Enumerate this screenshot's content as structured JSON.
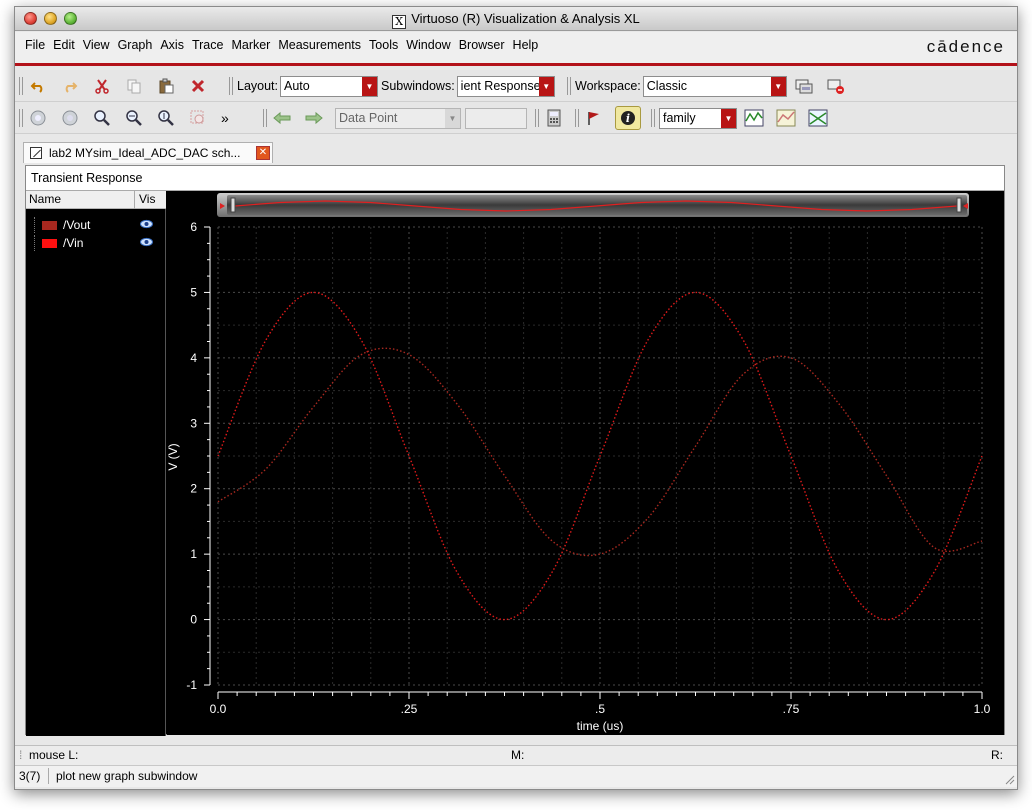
{
  "window": {
    "title": "Virtuoso (R) Visualization & Analysis XL",
    "title_icon_glyph": "X"
  },
  "menu": {
    "items": [
      "File",
      "Edit",
      "View",
      "Graph",
      "Axis",
      "Trace",
      "Marker",
      "Measurements",
      "Tools",
      "Window",
      "Browser",
      "Help"
    ],
    "brand": "cādence",
    "brand_color": "#b3121a"
  },
  "toolbar1": {
    "layout_label": "Layout:",
    "layout_value": "Auto",
    "subwindows_label": "Subwindows:",
    "subwindows_value": "ient Response",
    "workspace_label": "Workspace:",
    "workspace_value": "Classic",
    "icons": [
      "undo-icon",
      "redo-icon",
      "cut-icon",
      "copy-icon",
      "paste-icon",
      "delete-icon",
      "workspace-save-icon",
      "workspace-delete-icon"
    ]
  },
  "toolbar2": {
    "more_glyph": "»",
    "marker_type_value": "Data Point",
    "marker_value_input": "",
    "family_value": "family",
    "icons": [
      "zoom-fit-icon",
      "zoom-out-icon",
      "zoom-in-icon",
      "zoom-x-icon",
      "zoom-y-icon",
      "zoom-box-icon",
      "nav-back-icon",
      "nav-forward-icon",
      "calculator-icon",
      "flag-icon",
      "info-icon",
      "strip-icon",
      "graph-icon",
      "color-icon"
    ]
  },
  "tab": {
    "label": "lab2 MYsim_Ideal_ADC_DAC sch..."
  },
  "panel": {
    "title": "Transient Response",
    "legend_header_name": "Name",
    "legend_header_vis": "Vis",
    "traces": [
      {
        "name": "/Vout",
        "color": "#a8281f"
      },
      {
        "name": "/Vin",
        "color": "#ff1010"
      }
    ]
  },
  "chart_data": {
    "type": "line",
    "title": "",
    "xlabel": "time (us)",
    "ylabel": "V (V)",
    "xlim": [
      0.0,
      1.0
    ],
    "ylim": [
      -1,
      6
    ],
    "xticks": [
      {
        "v": 0.0,
        "label": "0.0"
      },
      {
        "v": 0.25,
        "label": ".25"
      },
      {
        "v": 0.5,
        "label": ".5"
      },
      {
        "v": 0.75,
        "label": ".75"
      },
      {
        "v": 1.0,
        "label": "1.0"
      }
    ],
    "yticks": [
      -1,
      0,
      1,
      2,
      3,
      4,
      5,
      6
    ],
    "grid": true,
    "background": "#000000",
    "series": [
      {
        "name": "/Vin",
        "color": "#e01a1a",
        "x": [
          0.0,
          0.0625,
          0.125,
          0.1875,
          0.25,
          0.3125,
          0.375,
          0.4375,
          0.5,
          0.5625,
          0.625,
          0.6875,
          0.75,
          0.8125,
          0.875,
          0.9375,
          1.0
        ],
        "values": [
          2.5,
          4.27,
          5.0,
          4.27,
          2.5,
          0.73,
          0.0,
          0.73,
          2.5,
          4.27,
          5.0,
          4.27,
          2.5,
          0.73,
          0.0,
          0.73,
          2.5
        ]
      },
      {
        "name": "/Vout",
        "color": "#a8281f",
        "x": [
          0.0,
          0.0625,
          0.125,
          0.1875,
          0.25,
          0.3125,
          0.375,
          0.4375,
          0.5,
          0.5625,
          0.625,
          0.6875,
          0.75,
          0.8125,
          0.875,
          0.9375,
          1.0
        ],
        "values": [
          1.8,
          2.3,
          3.25,
          4.05,
          4.05,
          3.3,
          2.2,
          1.2,
          1.0,
          1.55,
          2.65,
          3.75,
          4.0,
          3.3,
          2.2,
          1.1,
          1.2
        ]
      }
    ]
  },
  "status": {
    "mouse_label": "mouse L:",
    "middle_label": "M:",
    "right_label": "R:",
    "counter": "3(7)",
    "message": "plot new graph subwindow"
  }
}
